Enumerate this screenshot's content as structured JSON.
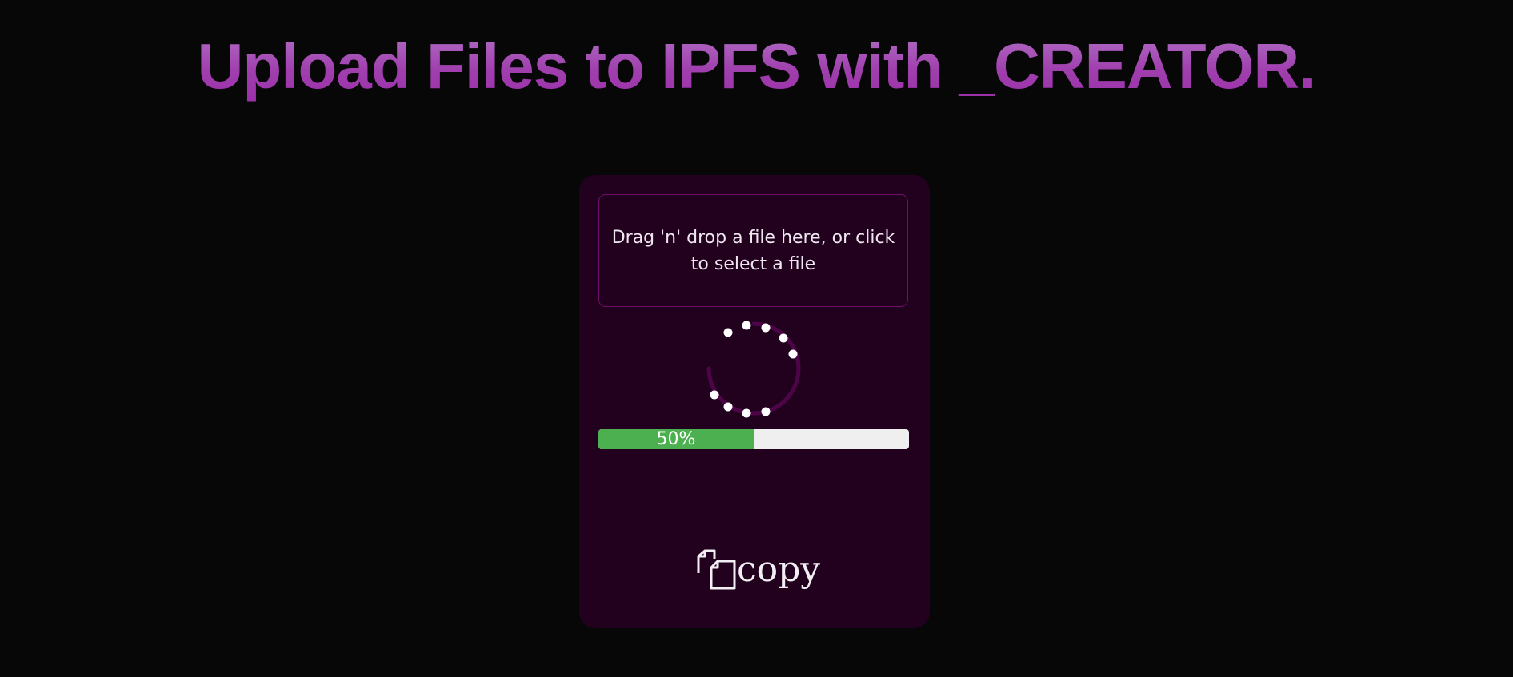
{
  "header": {
    "title": "Upload Files to IPFS with _CREATOR."
  },
  "uploader": {
    "dropzone_text": "Drag 'n' drop a file here, or click to select a file",
    "progress": {
      "value": 0.5,
      "label": "50%"
    },
    "copy_label": "copy"
  },
  "icons": {
    "spinner": "loading-spinner-icon",
    "copy": "copy-icon"
  },
  "colors": {
    "background": "#070707",
    "card": "#22011f",
    "accent": "#a03fae",
    "progress_fill": "#4caf50",
    "progress_track": "#efefef"
  }
}
